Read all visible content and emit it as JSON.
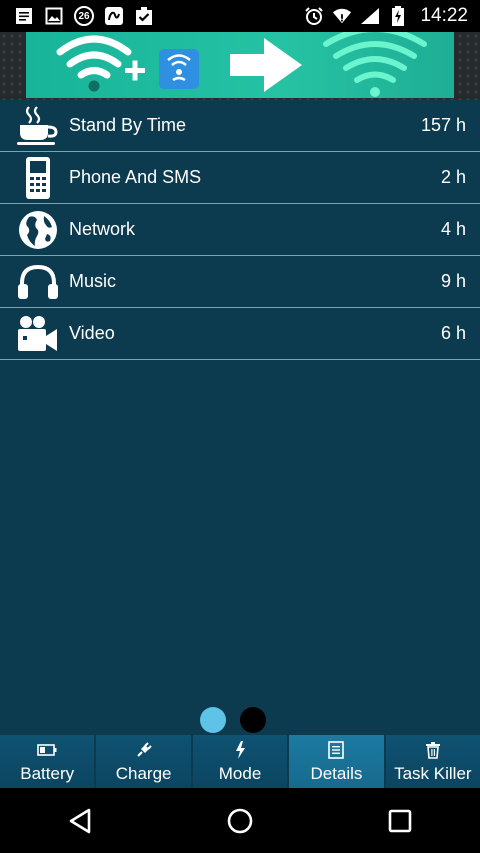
{
  "status_bar": {
    "time": "14:22",
    "badge_number": "26",
    "left_icons": [
      "notes-icon",
      "image-icon",
      "number-badge-icon",
      "signature-icon",
      "clipboard-check-icon"
    ],
    "right_icons": [
      "alarm-icon",
      "wifi-icon",
      "cell-signal-icon",
      "battery-charging-icon"
    ]
  },
  "ad": {
    "icons": [
      "wifi-icon",
      "plus-icon",
      "wifi-app-icon",
      "arrow-right-icon",
      "wifi-large-icon"
    ],
    "accent_color": "#1fb89c"
  },
  "list": {
    "items": [
      {
        "icon": "coffee-cup-icon",
        "label": "Stand By Time",
        "value": "157 h"
      },
      {
        "icon": "phone-icon",
        "label": "Phone And SMS",
        "value": "2 h"
      },
      {
        "icon": "globe-icon",
        "label": "Network",
        "value": "4 h"
      },
      {
        "icon": "headphones-icon",
        "label": "Music",
        "value": "9 h"
      },
      {
        "icon": "video-camera-icon",
        "label": "Video",
        "value": "6 h"
      }
    ]
  },
  "pager": {
    "active_color": "#5fc3e8",
    "inactive_color": "#000000",
    "active_index": 0,
    "count": 2
  },
  "tabs": [
    {
      "icon": "battery-icon",
      "label": "Battery",
      "active": false
    },
    {
      "icon": "plug-icon",
      "label": "Charge",
      "active": false
    },
    {
      "icon": "lightning-icon",
      "label": "Mode",
      "active": false
    },
    {
      "icon": "document-icon",
      "label": "Details",
      "active": true
    },
    {
      "icon": "trash-icon",
      "label": "Task Killer",
      "active": false
    }
  ],
  "nav": {
    "buttons": [
      "back-icon",
      "home-icon",
      "recents-icon"
    ]
  }
}
